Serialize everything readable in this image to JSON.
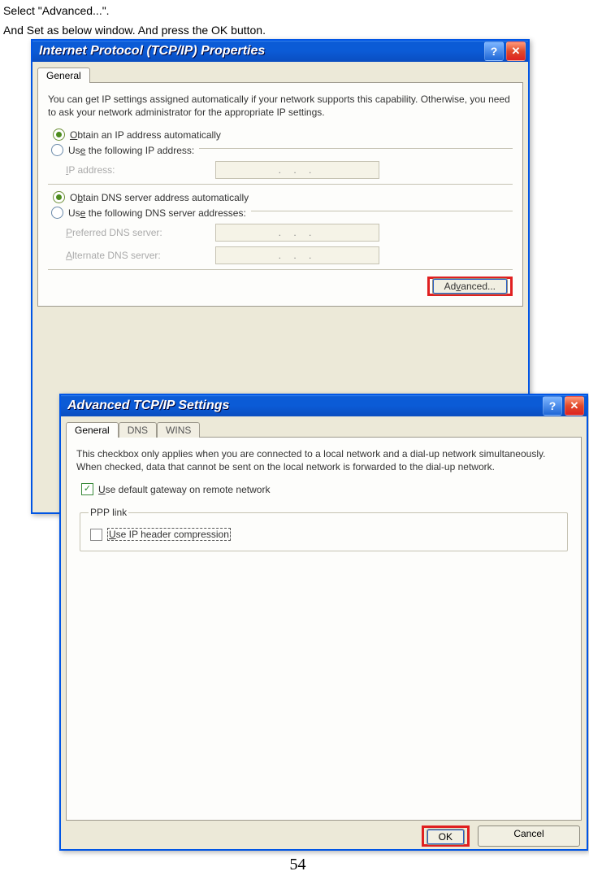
{
  "instructions": {
    "line1": "Select \"Advanced...\".",
    "line2": "And Set as below window. And press the OK button."
  },
  "tcpip": {
    "title": "Internet Protocol (TCP/IP) Properties",
    "tab_general": "General",
    "desc": "You can get IP settings assigned automatically if your network supports this capability. Otherwise, you need to ask your network administrator for the appropriate IP settings.",
    "r_auto_ip_pre": "O",
    "r_auto_ip_post": "btain an IP address automatically",
    "r_use_ip_pre": "Us",
    "r_use_ip_post": "e the following IP address:",
    "ip_label_pre": "I",
    "ip_label_post": "P address:",
    "r_auto_dns_pre": "O",
    "r_auto_dns_post": "btain DNS server address automatically",
    "r_use_dns_pre": "Us",
    "r_use_dns_post": "e the following DNS server addresses:",
    "pref_dns_pre": "P",
    "pref_dns_post": "referred DNS server:",
    "alt_dns_pre": "A",
    "alt_dns_post": "lternate DNS server:",
    "advanced_pre": "Ad",
    "advanced_post": "vanced...",
    "dots": ".      .      ."
  },
  "adv": {
    "title": "Advanced TCP/IP Settings",
    "tabs": {
      "general": "General",
      "dns": "DNS",
      "wins": "WINS"
    },
    "desc": "This checkbox only applies when you are connected to a local network and a dial-up network simultaneously.  When checked, data that cannot be sent on the local network is forwarded to the dial-up network.",
    "c_gateway_pre": "U",
    "c_gateway_post": "se default gateway on remote network",
    "ppp_legend": "PPP link",
    "c_hdr_pre": "U",
    "c_hdr_post": "se IP header compression",
    "ok": "OK",
    "cancel": "Cancel"
  },
  "page_number": "54"
}
